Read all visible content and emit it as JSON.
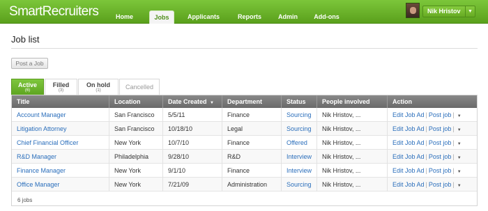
{
  "app": {
    "logo": "SmartRecruiters"
  },
  "nav": [
    {
      "label": "Home",
      "active": false
    },
    {
      "label": "Jobs",
      "active": true
    },
    {
      "label": "Applicants",
      "active": false
    },
    {
      "label": "Reports",
      "active": false
    },
    {
      "label": "Admin",
      "active": false
    },
    {
      "label": "Add-ons",
      "active": false
    }
  ],
  "user": {
    "name": "Nik Hristov"
  },
  "page": {
    "title": "Job list",
    "post_button": "Post a Job"
  },
  "tabs": [
    {
      "label": "Active",
      "count": "(6)"
    },
    {
      "label": "Filled",
      "count": "(3)"
    },
    {
      "label": "On hold",
      "count": "(1)"
    },
    {
      "label": "Cancelled",
      "count": ""
    }
  ],
  "table": {
    "columns": [
      "Title",
      "Location",
      "Date Created",
      "Department",
      "Status",
      "People involved",
      "Action"
    ],
    "sort_indicator": "▼",
    "action_edit": "Edit Job Ad",
    "action_post": "Post job",
    "rows": [
      {
        "title": "Account Manager",
        "location": "San Francisco",
        "date": "5/5/11",
        "department": "Finance",
        "status": "Sourcing",
        "people": "Nik Hristov, ..."
      },
      {
        "title": "Litigation Attorney",
        "location": "San Francisco",
        "date": "10/18/10",
        "department": "Legal",
        "status": "Sourcing",
        "people": "Nik Hristov, ..."
      },
      {
        "title": "Chief Financial Officer",
        "location": "New York",
        "date": "10/7/10",
        "department": "Finance",
        "status": "Offered",
        "people": "Nik Hristov, ..."
      },
      {
        "title": "R&D Manager",
        "location": "Philadelphia",
        "date": "9/28/10",
        "department": "R&D",
        "status": "Interview",
        "people": "Nik Hristov, ..."
      },
      {
        "title": "Finance Manager",
        "location": "New York",
        "date": "9/1/10",
        "department": "Finance",
        "status": "Interview",
        "people": "Nik Hristov, ..."
      },
      {
        "title": "Office Manager",
        "location": "New York",
        "date": "7/21/09",
        "department": "Administration",
        "status": "Sourcing",
        "people": "Nik Hristov, ..."
      }
    ],
    "footer": "6 jobs"
  },
  "colors": {
    "brand_green": "#5aa01c",
    "link_blue": "#2a6ebb",
    "header_gray": "#7a7a7a"
  }
}
